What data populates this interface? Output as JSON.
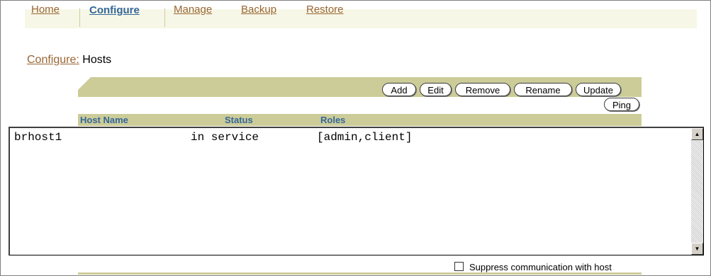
{
  "nav": {
    "tabs": [
      {
        "label": "Home"
      },
      {
        "label": "Configure"
      },
      {
        "label": "Manage"
      },
      {
        "label": "Backup"
      },
      {
        "label": "Restore"
      }
    ],
    "active_tab": "Configure"
  },
  "breadcrumb": {
    "link": "Configure:",
    "current": "Hosts"
  },
  "toolbar": {
    "add": "Add",
    "edit": "Edit",
    "remove": "Remove",
    "rename": "Rename",
    "update": "Update",
    "ping": "Ping"
  },
  "table": {
    "columns": [
      "Host Name",
      "Status",
      "Roles"
    ],
    "rows": [
      {
        "host": "brhost1",
        "status": "in service",
        "roles": "[admin,client]"
      }
    ]
  },
  "footer": {
    "suppress_label": "Suppress communication with host",
    "suppress_checked": false
  },
  "colors": {
    "accent": "#cccc99",
    "link": "#996633",
    "active": "#336699"
  }
}
